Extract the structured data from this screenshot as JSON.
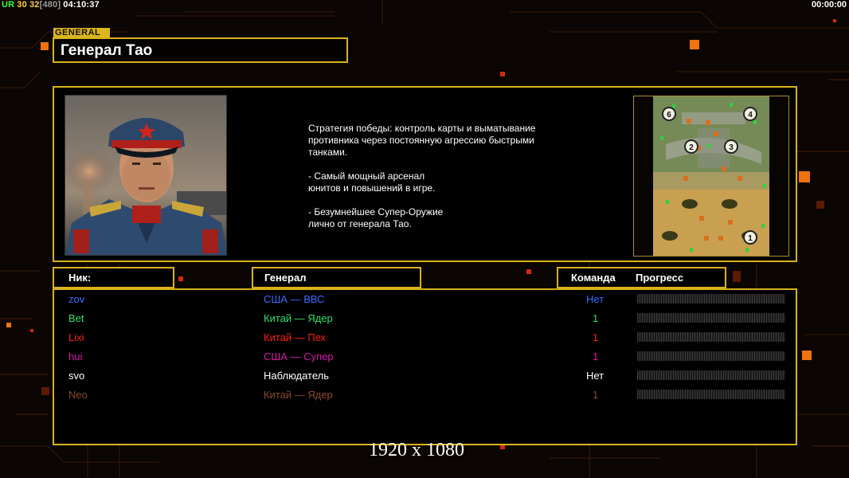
{
  "hud": {
    "left": [
      {
        "text": "UR",
        "color": "#39ff3c"
      },
      {
        "text": "30",
        "color": "#ffd24a"
      },
      {
        "text": "32",
        "color": "#ffd24a"
      },
      {
        "text": "[480]",
        "color": "#9c9c9c"
      },
      {
        "text": "04:10:37",
        "color": "#ffffff"
      }
    ],
    "right_clock": "00:00:00"
  },
  "general": {
    "tag": "GENERAL",
    "name": "Генерал Тао",
    "description": "Стратегия победы: контроль карты и выматывание\n противника через постоянную агрессию быстрыми\n танками.\n\n- Самый мощный арсенал\nюнитов и повышений в игре.\n\n- Безумнейшее Супер-Оружие\nлично от генерала Тао."
  },
  "minimap": {
    "slots": [
      "6",
      "4",
      "2",
      "3",
      "1"
    ]
  },
  "table": {
    "headers": {
      "nick": "Ник:",
      "general": "Генерал",
      "team": "Команда",
      "progress": "Прогресс"
    },
    "rows": [
      {
        "nick": "zov",
        "general": "США — ВВС",
        "team": "Нет",
        "color": "#3b6cff"
      },
      {
        "nick": "Bet",
        "general": "Китай — Ядер",
        "team": "1",
        "color": "#33e070"
      },
      {
        "nick": "Lixi",
        "general": "Китай — Пех",
        "team": "1",
        "color": "#ff1d1d"
      },
      {
        "nick": "hui",
        "general": "США — Супер",
        "team": "1",
        "color": "#d41ca8"
      },
      {
        "nick": "svo",
        "general": "Наблюдатель",
        "team": "Нет",
        "color": "#ffffff"
      },
      {
        "nick": "Neo",
        "general": "Китай — Ядер",
        "team": "1",
        "color": "#8a4a30"
      }
    ]
  },
  "watermark": "1920 x 1080"
}
